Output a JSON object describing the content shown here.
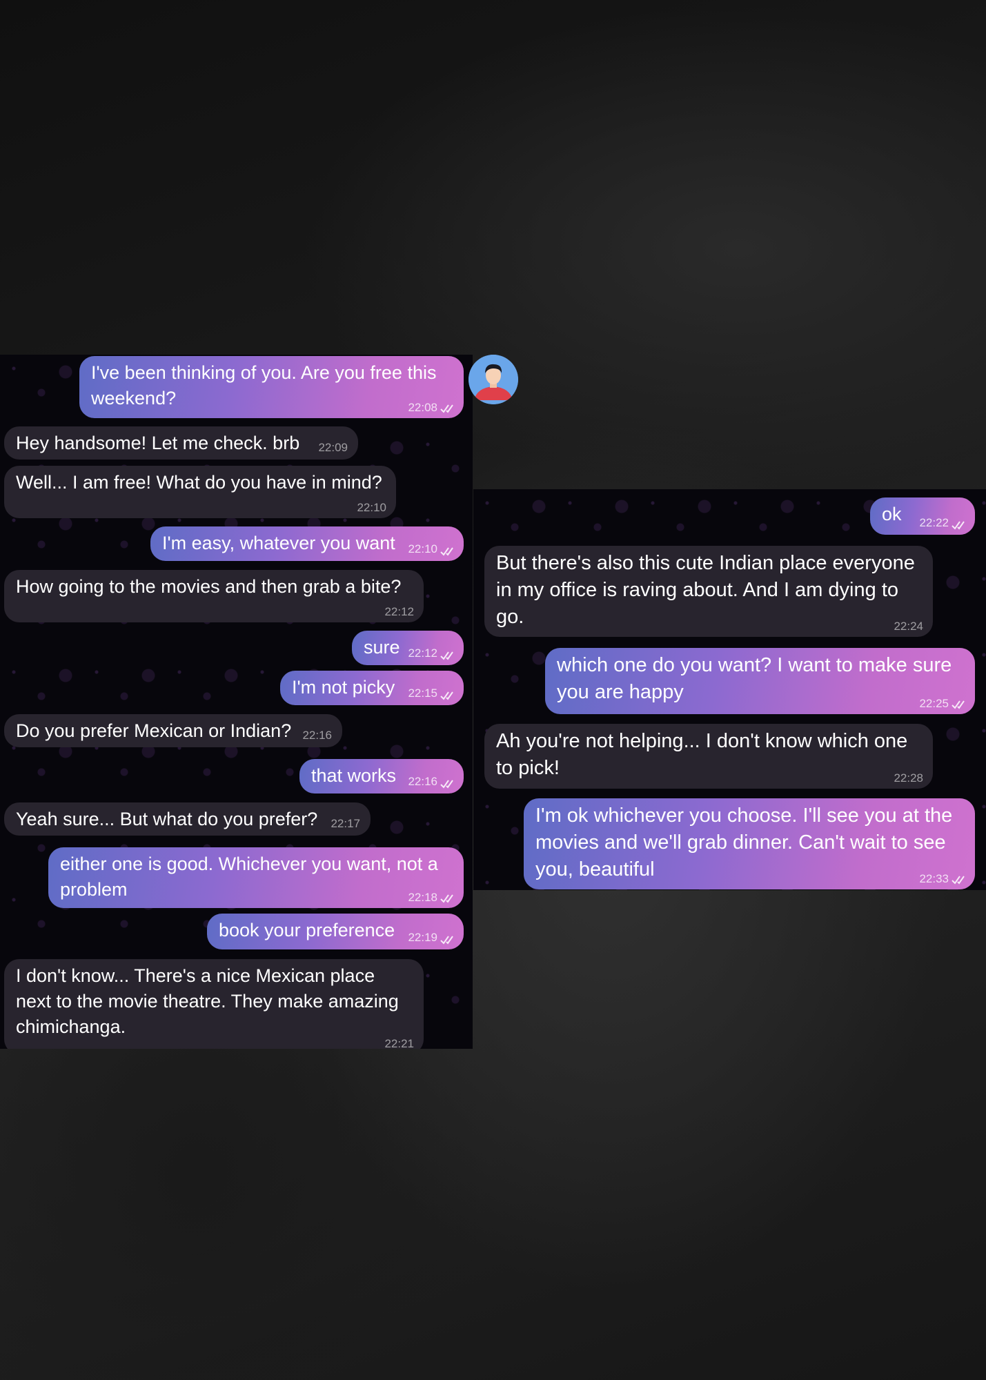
{
  "left_messages": [
    {
      "text": "I've been thinking of you. Are you free this weekend?",
      "time": "22:08"
    },
    {
      "text": "Hey handsome! Let me check. brb",
      "time": "22:09"
    },
    {
      "text": "Well... I am free! What do you have in mind?",
      "time": "22:10"
    },
    {
      "text": "I'm easy, whatever you want",
      "time": "22:10"
    },
    {
      "text": "How going to the movies and then grab a bite?",
      "time": "22:12"
    },
    {
      "text": "sure",
      "time": "22:12"
    },
    {
      "text": "I'm not picky",
      "time": "22:15"
    },
    {
      "text": "Do you prefer Mexican or Indian?",
      "time": "22:16"
    },
    {
      "text": "that works",
      "time": "22:16"
    },
    {
      "text": "Yeah sure... But what do you prefer?",
      "time": "22:17"
    },
    {
      "text": "either one is good. Whichever you want, not a problem",
      "time": "22:18"
    },
    {
      "text": "book your preference",
      "time": "22:19"
    },
    {
      "text": "I don't know... There's a nice Mexican place next to the movie theatre. They make amazing chimichanga.",
      "time": "22:21"
    }
  ],
  "right_messages": [
    {
      "text": "ok",
      "time": "22:22"
    },
    {
      "text": "But there's also this cute Indian place everyone in my office is raving about. And I am dying to go.",
      "time": "22:24"
    },
    {
      "text": "which one do you want? I want to make sure you are happy",
      "time": "22:25"
    },
    {
      "text": "Ah you're not helping... I don't know which one to pick!",
      "time": "22:28"
    },
    {
      "text": "I'm ok whichever you choose. I'll see you at the movies and we'll grab dinner. Can't wait to see you, beautiful",
      "time": "22:33"
    }
  ],
  "icons": {
    "read_receipt": "double-check-icon",
    "avatar": "user-avatar-icon"
  },
  "colors": {
    "incoming_bubble": "#28242e",
    "outgoing_gradient_start": "#5f6cc6",
    "outgoing_gradient_end": "#cf72cf",
    "chat_background": "#07060c"
  }
}
